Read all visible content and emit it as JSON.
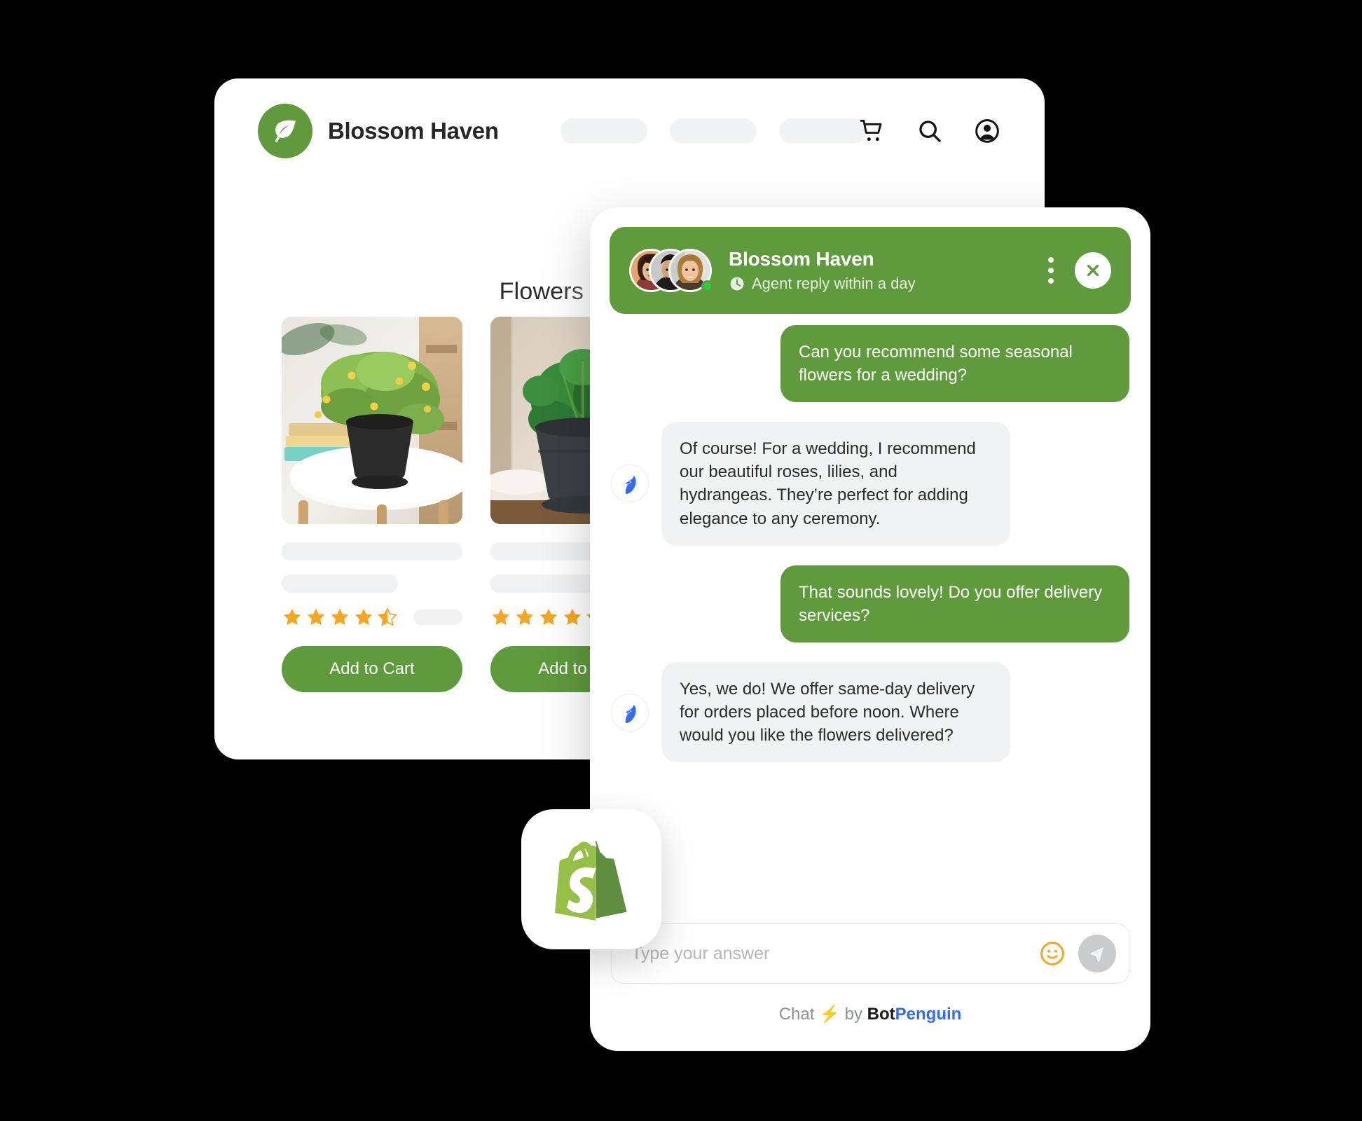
{
  "store": {
    "brand_name": "Blossom Haven",
    "logo_icon": "leaf-icon",
    "nav_placeholders": [
      "",
      "",
      ""
    ],
    "header_icons": [
      "cart-icon",
      "search-icon",
      "account-icon"
    ],
    "hero_title": "Flowers  that tells a story",
    "products": [
      {
        "image_alt": "potted plant with yellow flowers on white table",
        "rating": 4.5,
        "stars_full": 4,
        "stars_half": 1,
        "cta_label": "Add to Cart"
      },
      {
        "image_alt": "dark green leafy plant in grey pot",
        "rating": 4.5,
        "stars_full": 4,
        "stars_half": 1,
        "cta_label": "Add to Cart"
      }
    ]
  },
  "chat": {
    "header": {
      "title": "Blossom Haven",
      "status": "Agent reply within a day",
      "status_icon": "clock-icon",
      "menu_icon": "kebab-menu-icon",
      "close_icon": "close-icon",
      "online": true,
      "avatar_count": 3
    },
    "messages": [
      {
        "sender": "user",
        "text": "Can you recommend some seasonal flowers for a wedding?"
      },
      {
        "sender": "bot",
        "text": "Of course! For a wedding, I recommend our beautiful roses, lilies, and hydrangeas. They’re perfect for adding elegance to any ceremony."
      },
      {
        "sender": "user",
        "text": "That sounds lovely! Do you offer delivery services?"
      },
      {
        "sender": "bot",
        "text": "Yes, we do! We offer same-day delivery for orders placed before noon. Where would you like the flowers delivered?"
      }
    ],
    "input": {
      "value": "",
      "placeholder": "Type your answer",
      "emoji_icon": "smiley-icon",
      "send_icon": "send-icon"
    },
    "footer": {
      "prefix": "Chat",
      "bolt": "⚡",
      "by": "by",
      "brand_first": "Bot",
      "brand_second": "Penguin"
    }
  },
  "badge": {
    "icon": "shopify-logo",
    "label": "Shopify"
  },
  "colors": {
    "brand_green": "#5f9a3c",
    "star_gold": "#f5a623",
    "penguin_blue": "#2f6df5",
    "skeleton_grey": "#f1f2f4",
    "page_background": "#000000"
  }
}
